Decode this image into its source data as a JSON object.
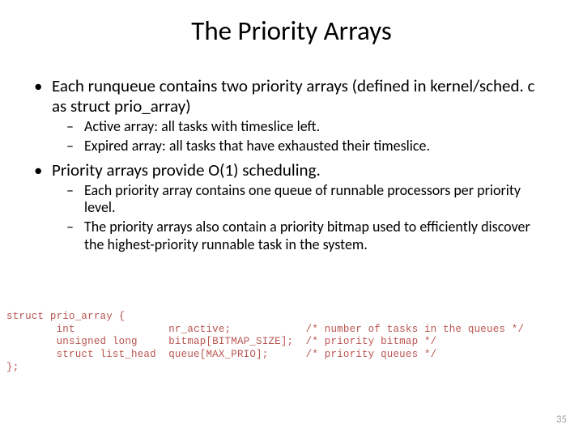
{
  "title": "The Priority Arrays",
  "bullets": [
    {
      "text": "Each runqueue contains two priority arrays (defined in kernel/sched. c as struct prio_array)",
      "sub": [
        "Active array: all tasks with timeslice left.",
        "Expired array: all tasks that have exhausted their timeslice."
      ]
    },
    {
      "text": "Priority arrays provide O(1) scheduling.",
      "sub": [
        "Each priority array contains one queue of runnable processors per priority level.",
        "The priority arrays also contain a priority bitmap used to efficiently discover the highest-priority runnable task in the system."
      ]
    }
  ],
  "code": "struct prio_array {\n        int               nr_active;            /* number of tasks in the queues */\n        unsigned long     bitmap[BITMAP_SIZE];  /* priority bitmap */\n        struct list_head  queue[MAX_PRIO];      /* priority queues */\n};",
  "page_number": "35"
}
